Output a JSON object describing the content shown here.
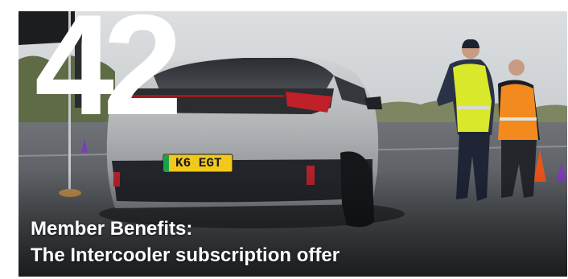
{
  "hero": {
    "issue_number": "42",
    "plate": "K6 EGT",
    "headline_line1": "Member Benefits:",
    "headline_line2": "The Intercooler subscription offer"
  },
  "colors": {
    "headline_text": "#ffffff",
    "vest_yellow": "#d9e82a",
    "vest_orange": "#f28a1e",
    "cone_orange": "#e8551c",
    "cone_purple": "#7a3fb0",
    "car_silver": "#b9bcbf"
  }
}
